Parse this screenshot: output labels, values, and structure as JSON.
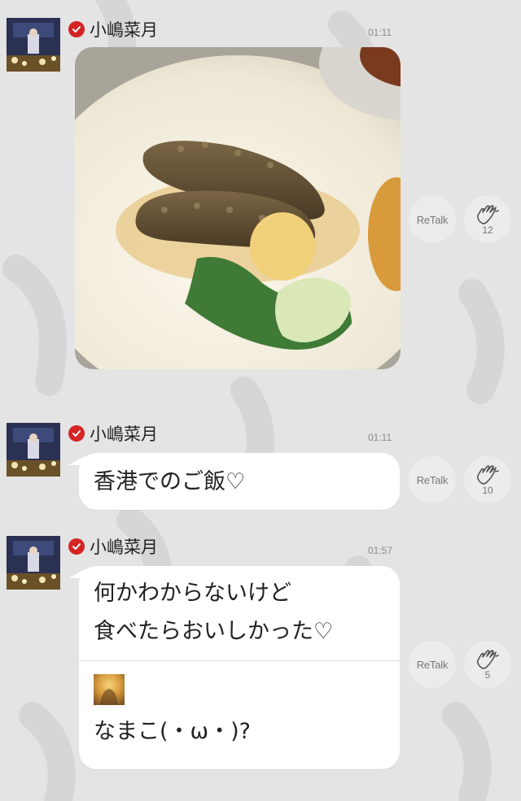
{
  "colors": {
    "background": "#e4e4e4",
    "bubble": "#ffffff",
    "verified_badge": "#d42424",
    "button": "#ececec"
  },
  "messages": [
    {
      "author": "小嶋菜月",
      "time": "01:11",
      "type": "photo",
      "retalk_label": "ReTalk",
      "clap_count": "12"
    },
    {
      "author": "小嶋菜月",
      "time": "01:11",
      "type": "text",
      "text": "香港でのご飯♡",
      "retalk_label": "ReTalk",
      "clap_count": "10"
    },
    {
      "author": "小嶋菜月",
      "time": "01:57",
      "type": "text-with-reply",
      "text": "何かわからないけど\n食べたらおいしかった♡",
      "reply_text": "なまこ(・ω・)?",
      "retalk_label": "ReTalk",
      "clap_count": "5"
    }
  ]
}
